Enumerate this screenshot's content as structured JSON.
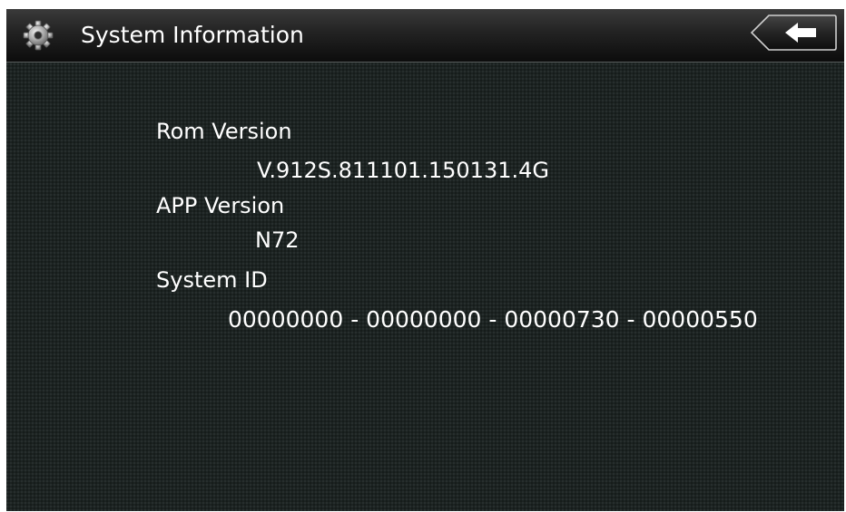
{
  "header": {
    "title": "System Information",
    "back_icon": "back-arrow-icon",
    "settings_icon": "gear-icon"
  },
  "info": {
    "rom_label": "Rom Version",
    "rom_value": "V.912S.811101.150131.4G",
    "app_label": "APP Version",
    "app_value": "N72",
    "system_id_label": "System ID",
    "system_id_value": "00000000 - 00000000 - 00000730 - 00000550"
  },
  "colors": {
    "background": "#1c2322",
    "text": "#ffffff",
    "titlebar_top": "#3a3a3a",
    "titlebar_bottom": "#0c0c0c"
  }
}
